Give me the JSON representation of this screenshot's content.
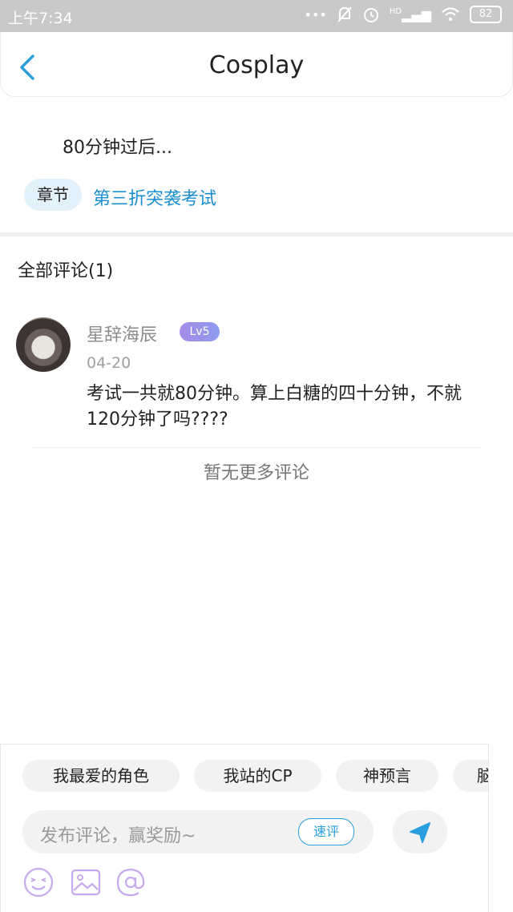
{
  "status_bar": {
    "time": "上午7:34",
    "battery": "82",
    "network": "HD"
  },
  "header": {
    "title": "Cosplay"
  },
  "post": {
    "text": "80分钟过后...",
    "chapter_tag": "章节",
    "chapter_title": "第三折突袭考试"
  },
  "comments": {
    "heading": "全部评论(1)",
    "items": [
      {
        "username": "星辞海辰",
        "level": "Lv5",
        "date": "04-20",
        "text": "考试一共就80分钟。算上白糖的四十分钟，不就120分钟了吗????"
      }
    ],
    "no_more": "暂无更多评论"
  },
  "bottom_bar": {
    "topics": [
      "我最爱的角色",
      "我站的CP",
      "神预言",
      "脑"
    ],
    "input_placeholder": "发布评论，赢奖励~",
    "quick_review_label": "速评"
  },
  "colors": {
    "accent": "#2a9fde",
    "link": "#1a8ed1",
    "badge": "#9b8fe8"
  }
}
